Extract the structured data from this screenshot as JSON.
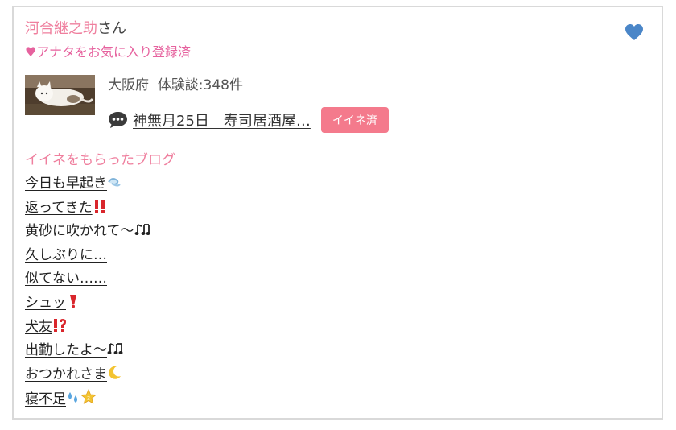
{
  "user": {
    "name": "河合継之助",
    "honorific": "さん",
    "favorite_status": "♥アナタをお気に入り登録済",
    "location": "大阪府",
    "reviews_label": "体験談:348件"
  },
  "diary": {
    "title": "神無月25日　寿司居酒屋…",
    "iine_button": "イイネ済"
  },
  "blogs": {
    "section_title": "イイネをもらったブログ",
    "items": [
      {
        "text": "今日も早起き",
        "emoji": "wind-face-icon"
      },
      {
        "text": "返ってきた",
        "emoji": "double-exclamation-icon"
      },
      {
        "text": "黄砂に吹かれて〜",
        "emoji": "music-notes-icon"
      },
      {
        "text": "久しぶりに…",
        "emoji": ""
      },
      {
        "text": "似てない……",
        "emoji": ""
      },
      {
        "text": "シュッ",
        "emoji": "heavy-exclamation-icon"
      },
      {
        "text": "犬友",
        "emoji": "exclamation-question-icon"
      },
      {
        "text": "出勤したよ〜",
        "emoji": "music-notes-icon"
      },
      {
        "text": "おつかれさま",
        "emoji": "crescent-moon-icon"
      },
      {
        "text": "寝不足",
        "emoji": "sweat-droplets-star-icon"
      }
    ]
  },
  "colors": {
    "pink": "#ef7f9e",
    "button": "#f47a8c",
    "heart": "#4a86c8"
  }
}
